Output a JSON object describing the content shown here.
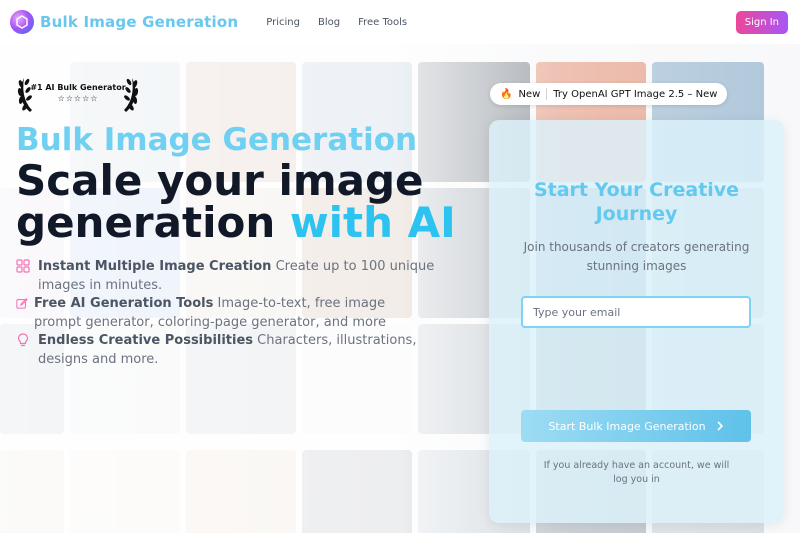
{
  "header": {
    "logo_text": "Bulk Image Generation",
    "nav": [
      "Pricing",
      "Blog",
      "Free Tools"
    ],
    "signin_label": "Sign In"
  },
  "badge": {
    "title": "#1 AI Bulk Generator",
    "stars": "☆☆☆☆☆"
  },
  "hero": {
    "kicker": "Bulk Image Generation",
    "line1": "Scale your image",
    "line2_main": "generation ",
    "line2_accent": "with AI"
  },
  "features": [
    {
      "icon": "grid-icon",
      "title": "Instant Multiple Image Creation",
      "text": " Create up to 100 unique",
      "text2": "images in minutes."
    },
    {
      "icon": "edit-icon",
      "title": "Free AI Generation Tools",
      "text": " Image-to-text, free image",
      "text2": "prompt generator, coloring-page generator, and more"
    },
    {
      "icon": "lightbulb-icon",
      "title": "Endless Creative Possibilities",
      "text": " Characters, illustrations,",
      "text2": "designs and more."
    }
  ],
  "pill": {
    "emoji": "🔥",
    "badge": "New",
    "text": "Try OpenAI GPT Image 2.5 – New"
  },
  "card": {
    "title_line1": "Start Your Creative",
    "title_line2": "Journey",
    "sub_line1": "Join thousands of creators generating",
    "sub_line2": "stunning images",
    "email_placeholder": "Type your email",
    "cta_label": "Start Bulk Image Generation",
    "note_line1": "If you already have an account, we will",
    "note_line2": "log you in"
  },
  "colors": {
    "accent": "#2dc3f0",
    "brand_light": "#6fd0f2",
    "signin_gradient_start": "#ec4899",
    "signin_gradient_end": "#a855f7"
  }
}
